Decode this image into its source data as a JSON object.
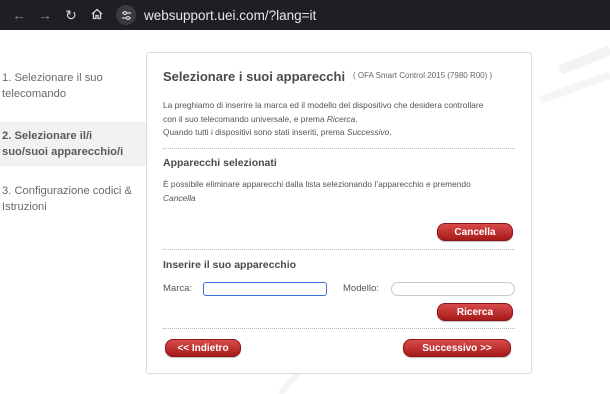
{
  "browser": {
    "url": "websupport.uei.com/?lang=it"
  },
  "sidebar": {
    "steps": [
      {
        "label": "1. Selezionare il suo telecomando"
      },
      {
        "label": "2. Selezionare il/i suo/suoi apparecchio/i"
      },
      {
        "label": "3. Configurazione codici & Istruzioni"
      }
    ]
  },
  "panel": {
    "title": "Selezionare i suoi apparecchi",
    "subtitle": "( OFA Smart Control 2015 (7980 R00) )",
    "intro_a": "La preghiamo di inserire la marca ed il modello del dispositivo che desidera controllare",
    "intro_b1": "con il suo telecomando universale, e prema ",
    "intro_b2": "Ricerca",
    "intro_b3": ".",
    "intro_c1": "Quando tutti i dispositivi sono stati inseriti, prema ",
    "intro_c2": "Successivo",
    "intro_c3": ".",
    "selected_heading": "Apparecchi selezionati",
    "selected_text": "È possibile eliminare apparecchi dalla lista selezionando l’apparecchio e premendo",
    "selected_text_em": "Cancella",
    "delete_button": "Cancella",
    "insert_heading": "Inserire il suo apparecchio",
    "brand_label": "Marca:",
    "brand_value": "",
    "model_label": "Modello:",
    "model_value": "",
    "search_button": "Ricerca",
    "back_button": "<< Indietro",
    "next_button": "Successivo >>"
  },
  "colors": {
    "accent_red": "#b82020",
    "focus_blue": "#3b6fd6"
  }
}
